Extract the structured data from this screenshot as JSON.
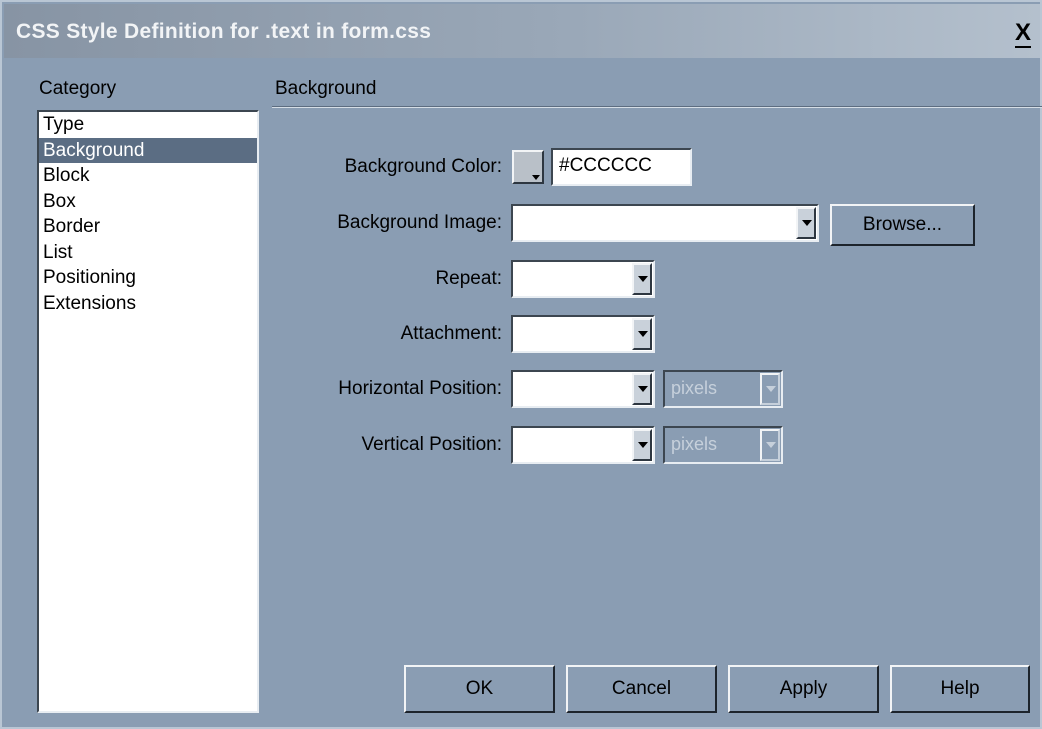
{
  "window": {
    "title": "CSS Style Definition for .text in form.css",
    "close_label": "X"
  },
  "category": {
    "header": "Category",
    "items": [
      {
        "label": "Type",
        "selected": false
      },
      {
        "label": "Background",
        "selected": true
      },
      {
        "label": "Block",
        "selected": false
      },
      {
        "label": "Box",
        "selected": false
      },
      {
        "label": "Border",
        "selected": false
      },
      {
        "label": "List",
        "selected": false
      },
      {
        "label": "Positioning",
        "selected": false
      },
      {
        "label": "Extensions",
        "selected": false
      }
    ]
  },
  "section": {
    "title": "Background"
  },
  "form": {
    "bg_color_label": "Background Color:",
    "bg_color_value": "#CCCCCC",
    "bg_image_label": "Background Image:",
    "bg_image_value": "",
    "browse_label": "Browse...",
    "repeat_label": "Repeat:",
    "repeat_value": "",
    "attachment_label": "Attachment:",
    "attachment_value": "",
    "hpos_label": "Horizontal Position:",
    "hpos_value": "",
    "hpos_unit": "pixels",
    "vpos_label": "Vertical Position:",
    "vpos_value": "",
    "vpos_unit": "pixels"
  },
  "buttons": {
    "ok": "OK",
    "cancel": "Cancel",
    "apply": "Apply",
    "help": "Help"
  },
  "colors": {
    "dialog_bg": "#8a9db3",
    "selection_bg": "#5b6d83",
    "swatch": "#CCCCCC"
  }
}
